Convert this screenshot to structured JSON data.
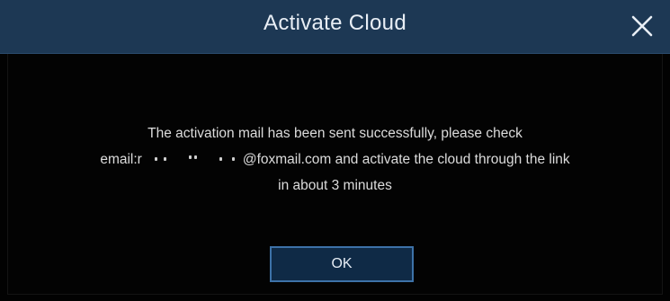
{
  "dialog": {
    "title": "Activate Cloud",
    "close_icon": "close-icon",
    "message": {
      "line1": "The activation mail has been sent successfully, please check",
      "line2_prefix": "email:r",
      "line2_suffix": "@foxmail.com and activate the cloud through the link",
      "line3": "in about 3 minutes"
    },
    "ok_label": "OK"
  },
  "colors": {
    "title_bar": "#1d3854",
    "background": "#020202",
    "button_fill": "#0f2a46",
    "button_border": "#3d72a8",
    "text": "#dcdcdc"
  }
}
